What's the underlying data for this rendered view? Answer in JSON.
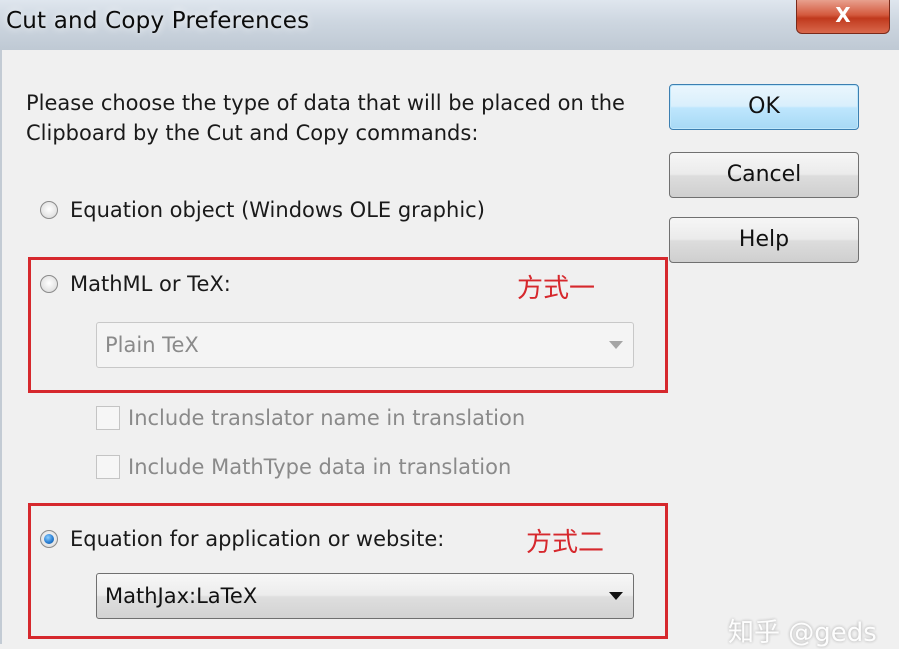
{
  "window": {
    "title": "Cut and Copy Preferences",
    "close_glyph": "X"
  },
  "instruction": "Please choose the type of data that will be placed on the Clipboard by the Cut and Copy commands:",
  "buttons": {
    "ok": "OK",
    "cancel": "Cancel",
    "help": "Help"
  },
  "options": {
    "equation_object": {
      "label": "Equation object (Windows OLE graphic)",
      "selected": false
    },
    "mathml_tex": {
      "label": "MathML or TeX:",
      "selected": false,
      "dropdown_value": "Plain TeX",
      "enabled": false
    },
    "include_translator": {
      "label": "Include translator name in translation",
      "checked": false,
      "enabled": false
    },
    "include_mathtype": {
      "label": "Include MathType data in translation",
      "checked": false,
      "enabled": false
    },
    "equation_app": {
      "label": "Equation for application or website:",
      "selected": true,
      "dropdown_value": "MathJax:LaTeX",
      "enabled": true
    }
  },
  "annotations": {
    "method_one": "方式一",
    "method_two": "方式二",
    "color": "#d6282d"
  },
  "watermark": "知乎 @geds"
}
